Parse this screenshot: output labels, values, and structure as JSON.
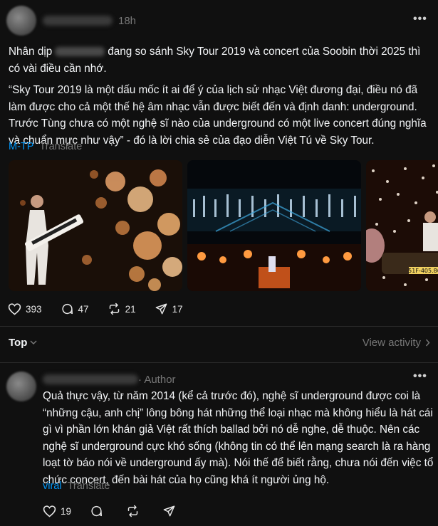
{
  "post": {
    "time": "18h",
    "text_intro_pre": "Nhân dịp",
    "text_intro_post": "đang so sánh Sky Tour 2019 và concert của Soobin thời 2025 thì có vài điều cần nhớ.",
    "text_quote": "“Sky Tour 2019 là một dấu mốc ít ai để ý của lịch sử nhạc Việt đương đại, điều nó đã làm được cho cả một thế hệ âm nhạc vẫn được biết đến và định danh: underground. Trước Tùng chưa có một nghệ sĩ nào của underground có một live concert đúng nghĩa và chuẩn mực như vậy” - đó là lời chia sẻ của đạo diễn Việt Tú về Sky Tour.",
    "tag": "M-TP",
    "translate": "Translate",
    "likes": "393",
    "comments": "47",
    "reposts": "21",
    "shares": "17",
    "photo3_plate": "51F-405.86"
  },
  "sort": {
    "label": "Top",
    "view_activity": "View activity"
  },
  "reply": {
    "author_label": "· Author",
    "text": "Quả thực vậy, từ năm 2014 (kể cả trước đó), nghệ sĩ underground được coi là “những cậu, anh chị” lông bông hát những thể loại nhạc mà không hiểu là hát cái gì vì phần lớn khán giả Việt rất thích ballad bởi nó dễ nghe, dễ thuộc. Nên các nghệ sĩ underground cực khó sống (không tin có thể lên mạng search là ra hàng loạt tờ báo nói về underground ấy mà). Nói thế để biết rằng, chưa nói đến việc tổ chức concert, đến bài hát của họ cũng khá ít người ủng hộ.",
    "tag": "viral",
    "translate": "Translate",
    "likes": "19"
  },
  "icons": [
    "more-icon",
    "heart-icon",
    "comment-icon",
    "repost-icon",
    "share-icon",
    "chevron-down-icon",
    "chevron-right-icon"
  ],
  "colors": {
    "background": "#101010",
    "link": "#0095f6",
    "muted": "#777777",
    "text": "#f3f5f7"
  }
}
